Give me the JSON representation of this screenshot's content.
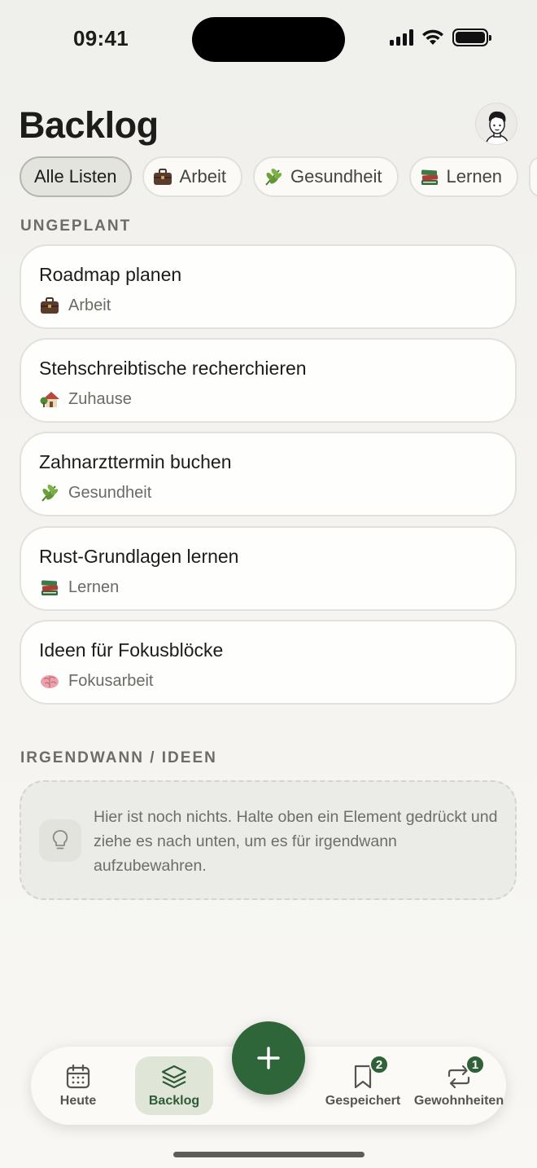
{
  "status_bar": {
    "time": "09:41"
  },
  "header": {
    "title": "Backlog"
  },
  "filters": [
    {
      "label": "Alle Listen",
      "icon": "none",
      "active": true
    },
    {
      "label": "Arbeit",
      "icon": "briefcase-icon",
      "active": false
    },
    {
      "label": "Gesundheit",
      "icon": "leaf-icon",
      "active": false
    },
    {
      "label": "Lernen",
      "icon": "books-icon",
      "active": false
    }
  ],
  "unplanned": {
    "heading": "UNGEPLANT",
    "items": [
      {
        "title": "Roadmap planen",
        "list": "Arbeit",
        "icon": "briefcase-icon"
      },
      {
        "title": "Stehschreibtische recherchieren",
        "list": "Zuhause",
        "icon": "house-icon"
      },
      {
        "title": "Zahnarzttermin buchen",
        "list": "Gesundheit",
        "icon": "leaf-icon"
      },
      {
        "title": "Rust-Grundlagen lernen",
        "list": "Lernen",
        "icon": "books-icon"
      },
      {
        "title": "Ideen für Fokusblöcke",
        "list": "Fokusarbeit",
        "icon": "brain-icon"
      }
    ]
  },
  "someday": {
    "heading": "IRGENDWANN / IDEEN",
    "empty_text": "Hier ist noch nichts. Halte oben ein Element gedrückt und ziehe es nach unten, um es für irgendwann aufzubewahren."
  },
  "tabbar": {
    "tabs": [
      {
        "label": "Heute",
        "icon": "calendar-icon",
        "active": false
      },
      {
        "label": "Backlog",
        "icon": "layers-icon",
        "active": true
      },
      {
        "label": "Gespeichert",
        "icon": "bookmark-icon",
        "active": false,
        "badge": "2"
      },
      {
        "label": "Gewohnheiten",
        "icon": "repeat-icon",
        "active": false,
        "badge": "1"
      }
    ],
    "fab_icon": "plus-icon"
  },
  "colors": {
    "accent": "#2f6639",
    "background": "#f3f2ee",
    "card": "#fefefd"
  }
}
